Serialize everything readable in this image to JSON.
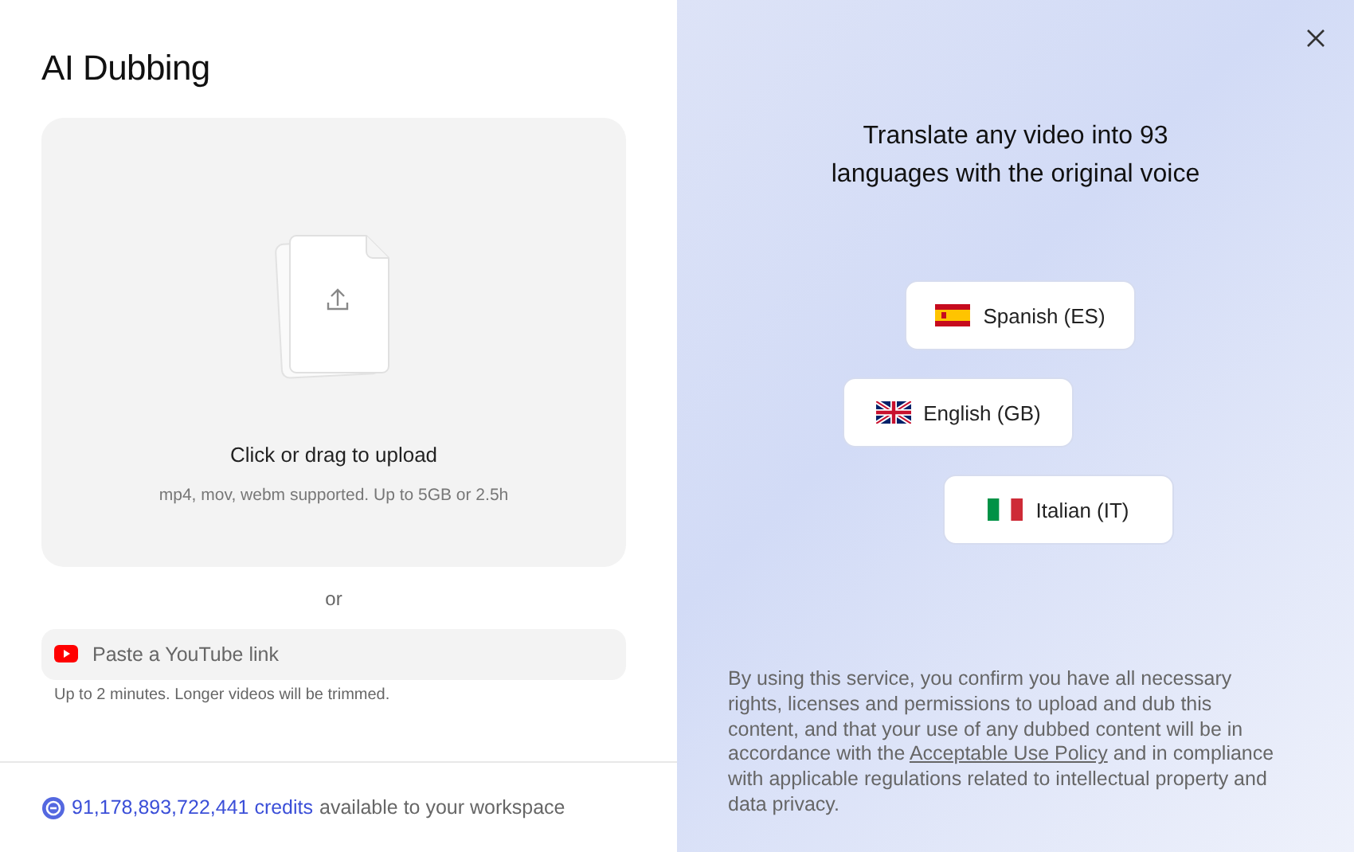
{
  "title": "AI Dubbing",
  "upload": {
    "label": "Click or drag to upload",
    "hint": "mp4, mov, webm supported. Up to 5GB or 2.5h"
  },
  "separator": "or",
  "youtube": {
    "placeholder": "Paste a YouTube link",
    "hint": "Up to 2 minutes. Longer videos will be trimmed."
  },
  "credits": {
    "amount": "91,178,893,722,441 credits",
    "text": "available to your workspace"
  },
  "promo": {
    "heading": "Translate any video into 93 languages with the original voice",
    "languages": [
      {
        "kind": "es",
        "label": "Spanish (ES)"
      },
      {
        "kind": "gb",
        "label": "English (GB)"
      },
      {
        "kind": "it",
        "label": "Italian (IT)"
      }
    ]
  },
  "disclaimer": {
    "before": "By using this service, you confirm you have all necessary rights, licenses and permissions to upload and dub this content, and that your use of any dubbed content will be in accordance with the",
    "link": "Acceptable Use Policy",
    "after": "and in compliance with applicable regulations related to intellectual property and data privacy."
  }
}
